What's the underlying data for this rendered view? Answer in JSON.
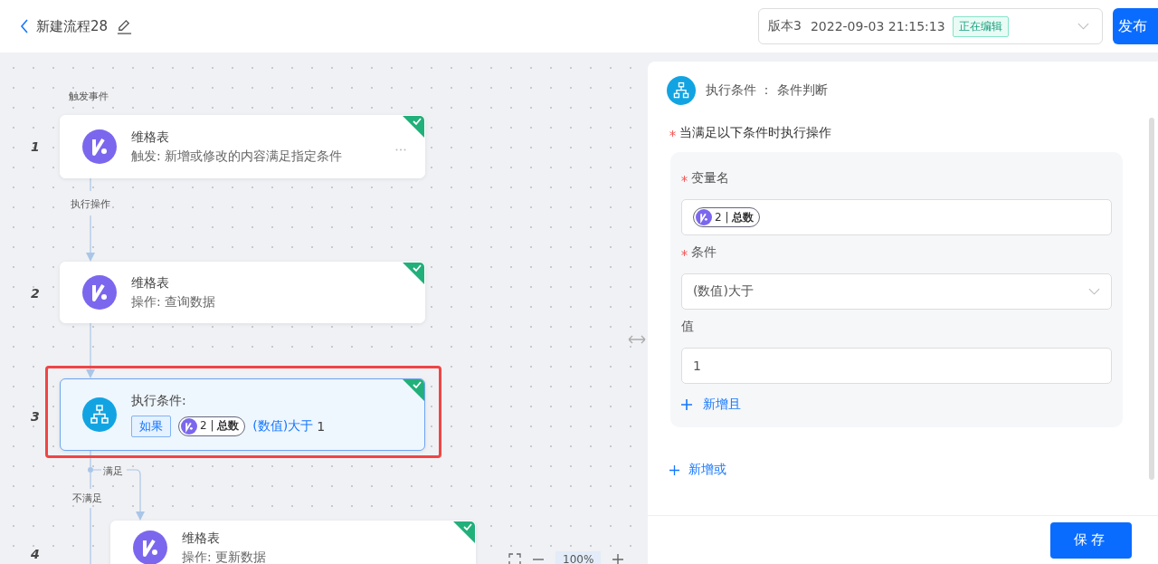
{
  "header": {
    "title": "新建流程28",
    "version_select": {
      "version": "版本3",
      "datetime": "2022-09-03 21:15:13",
      "status": "正在编辑"
    },
    "publish_button": "发布"
  },
  "canvas": {
    "trigger_label": "触发事件",
    "nodes": [
      {
        "number": "1",
        "kind": "app",
        "title": "维格表",
        "subtitle": "触发: 新增或修改的内容满足指定条件",
        "done": true,
        "selected": false,
        "show_menu": true
      },
      {
        "number": "2",
        "kind": "app",
        "title": "维格表",
        "subtitle": "操作: 查询数据",
        "done": true,
        "selected": false,
        "show_menu": false
      },
      {
        "number": "3",
        "kind": "condition",
        "title": "执行条件:",
        "tag": "如果",
        "chip": "2 | **总数**",
        "operator": "(数值)大于",
        "value": "1",
        "done": true,
        "selected": true,
        "show_menu": false
      },
      {
        "number": "4",
        "kind": "app",
        "title": "维格表",
        "subtitle": "操作: 更新数据",
        "done": true,
        "selected": false,
        "show_menu": false
      }
    ],
    "edge_labels": [
      "执行操作",
      "满足",
      "不满足"
    ],
    "zoom_level": "100%"
  },
  "panel": {
    "title": "执行条件 ： 条件判断",
    "section_label": "当满足以下条件时执行操作",
    "section_required": true,
    "fields": [
      {
        "kind": "chip",
        "label": "变量名",
        "required": true,
        "value": "2 | **总数**"
      },
      {
        "kind": "select",
        "label": "条件",
        "required": true,
        "value": "(数值)大于"
      },
      {
        "kind": "input",
        "label": "值",
        "required": false,
        "value": "1"
      }
    ],
    "add_and": "新增且",
    "add_or": "新增或",
    "save_button": "保存"
  }
}
